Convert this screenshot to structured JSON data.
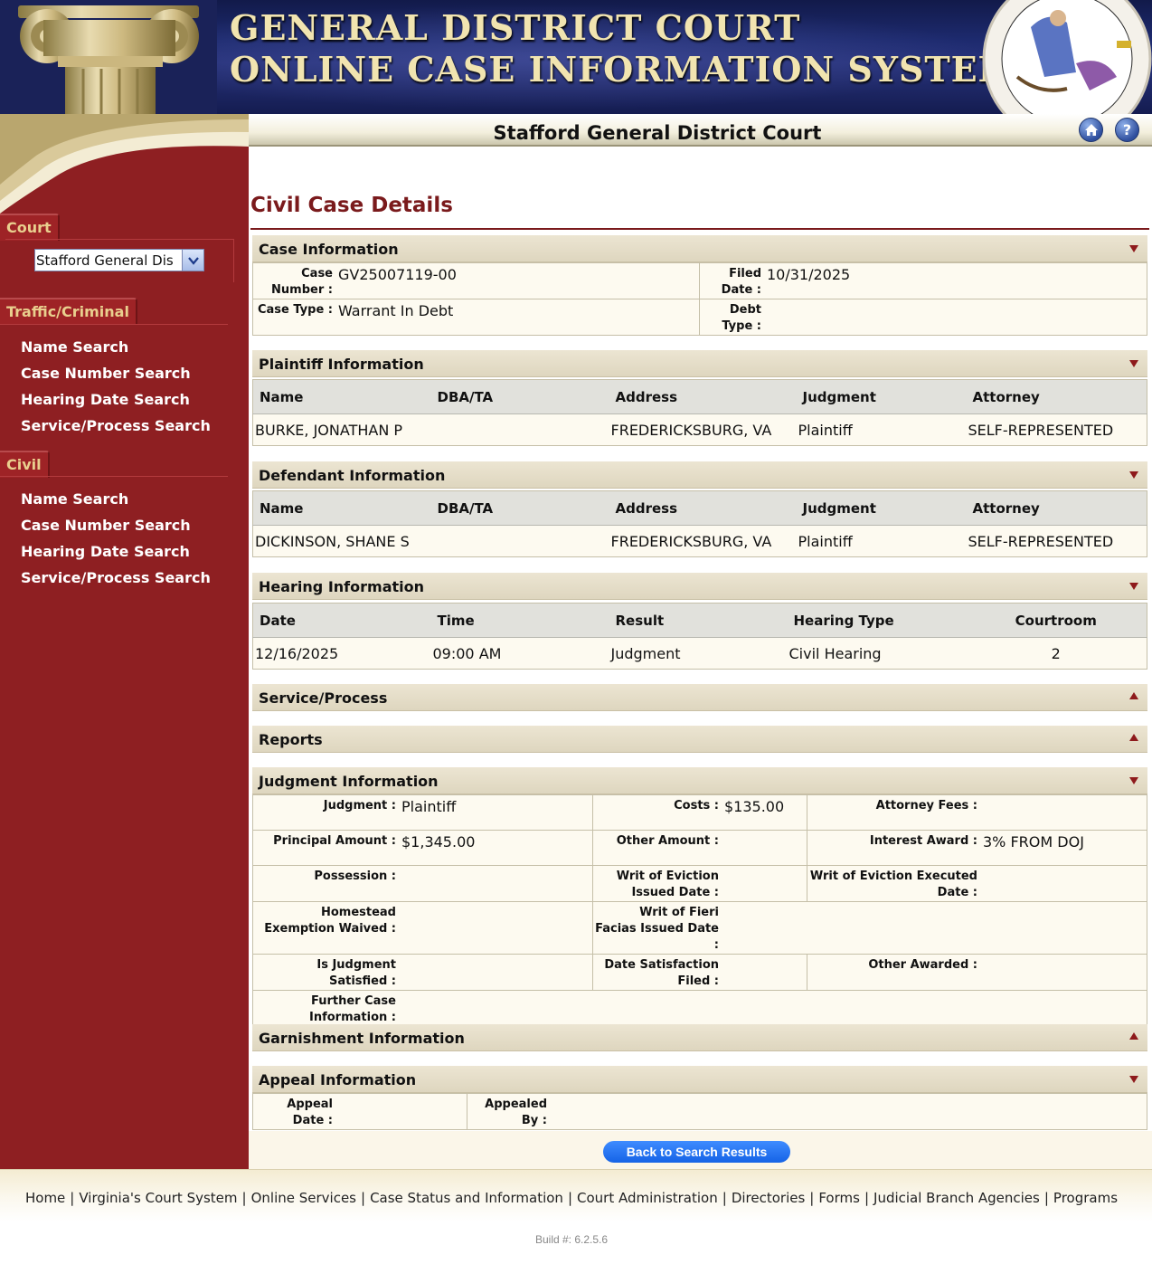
{
  "banner": {
    "line1": "GENERAL DISTRICT COURT",
    "line2": "ONLINE CASE INFORMATION SYSTEM"
  },
  "header": {
    "court_name": "Stafford General District Court"
  },
  "sidebar": {
    "court_tab": "Court",
    "court_select_value": "Stafford General Dis",
    "traffic_tab": "Traffic/Criminal",
    "traffic_links": [
      "Name Search",
      "Case Number Search",
      "Hearing Date Search",
      "Service/Process Search"
    ],
    "civil_tab": "Civil",
    "civil_links": [
      "Name Search",
      "Case Number Search",
      "Hearing Date Search",
      "Service/Process Search"
    ]
  },
  "page_title": "Civil Case Details",
  "case_info": {
    "title": "Case Information",
    "case_number_label": "Case Number :",
    "case_number": "GV25007119-00",
    "filed_date_label": "Filed Date :",
    "filed_date": "10/31/2025",
    "case_type_label": "Case Type :",
    "case_type": "Warrant In Debt",
    "debt_type_label": "Debt Type :",
    "debt_type": ""
  },
  "plaintiff": {
    "title": "Plaintiff Information",
    "headers": [
      "Name",
      "DBA/TA",
      "Address",
      "Judgment",
      "Attorney"
    ],
    "row": [
      "BURKE, JONATHAN P",
      "",
      "FREDERICKSBURG, VA",
      "Plaintiff",
      "SELF-REPRESENTED"
    ]
  },
  "defendant": {
    "title": "Defendant Information",
    "headers": [
      "Name",
      "DBA/TA",
      "Address",
      "Judgment",
      "Attorney"
    ],
    "row": [
      "DICKINSON, SHANE S",
      "",
      "FREDERICKSBURG, VA",
      "Plaintiff",
      "SELF-REPRESENTED"
    ]
  },
  "hearing": {
    "title": "Hearing Information",
    "headers": [
      "Date",
      "Time",
      "Result",
      "Hearing Type",
      "Courtroom"
    ],
    "row": [
      "12/16/2025",
      "09:00 AM",
      "Judgment",
      "Civil Hearing",
      "2"
    ]
  },
  "service_title": "Service/Process",
  "reports_title": "Reports",
  "judgment": {
    "title": "Judgment Information",
    "judgment_label": "Judgment :",
    "judgment": "Plaintiff",
    "costs_label": "Costs :",
    "costs": "$135.00",
    "attorney_fees_label": "Attorney Fees :",
    "attorney_fees": "",
    "principal_label": "Principal Amount :",
    "principal": "$1,345.00",
    "other_amount_label": "Other Amount :",
    "other_amount": "",
    "interest_label": "Interest Award :",
    "interest": "3% FROM DOJ",
    "possession_label": "Possession :",
    "possession": "",
    "writ_eviction_issued_label": "Writ of Eviction Issued Date :",
    "writ_eviction_issued": "",
    "writ_eviction_executed_label": "Writ of Eviction Executed Date :",
    "writ_eviction_executed": "",
    "homestead_label": "Homestead Exemption Waived :",
    "homestead": "",
    "writ_fieri_label": "Writ of Fieri Facias Issued Date :",
    "writ_fieri": "",
    "satisfied_label": "Is Judgment Satisfied :",
    "satisfied": "",
    "date_satisfaction_label": "Date Satisfaction Filed :",
    "date_satisfaction": "",
    "other_awarded_label": "Other Awarded :",
    "other_awarded": "",
    "further_label": "Further Case Information :",
    "further": ""
  },
  "garnishment_title": "Garnishment Information",
  "appeal": {
    "title": "Appeal Information",
    "appeal_date_label": "Appeal Date :",
    "appeal_date": "",
    "appealed_by_label": "Appealed By :",
    "appealed_by": ""
  },
  "back_button": "Back to Search Results",
  "footer": {
    "links": [
      "Home",
      "Virginia's Court System",
      "Online Services",
      "Case Status and Information",
      "Court Administration",
      "Directories",
      "Forms",
      "Judicial Branch Agencies",
      "Programs"
    ],
    "build": "Build #: 6.2.5.6"
  },
  "icons": {
    "home": "home-icon",
    "help": "help-icon",
    "dropdown": "chevron-down-icon",
    "expanded": "triangle-down-icon",
    "collapsed": "triangle-up-icon"
  },
  "colors": {
    "sidebar": "#8e1f22",
    "title_red": "#7a1a1c",
    "banner_text": "#f1e4b0",
    "button_blue": "#1563e6"
  }
}
